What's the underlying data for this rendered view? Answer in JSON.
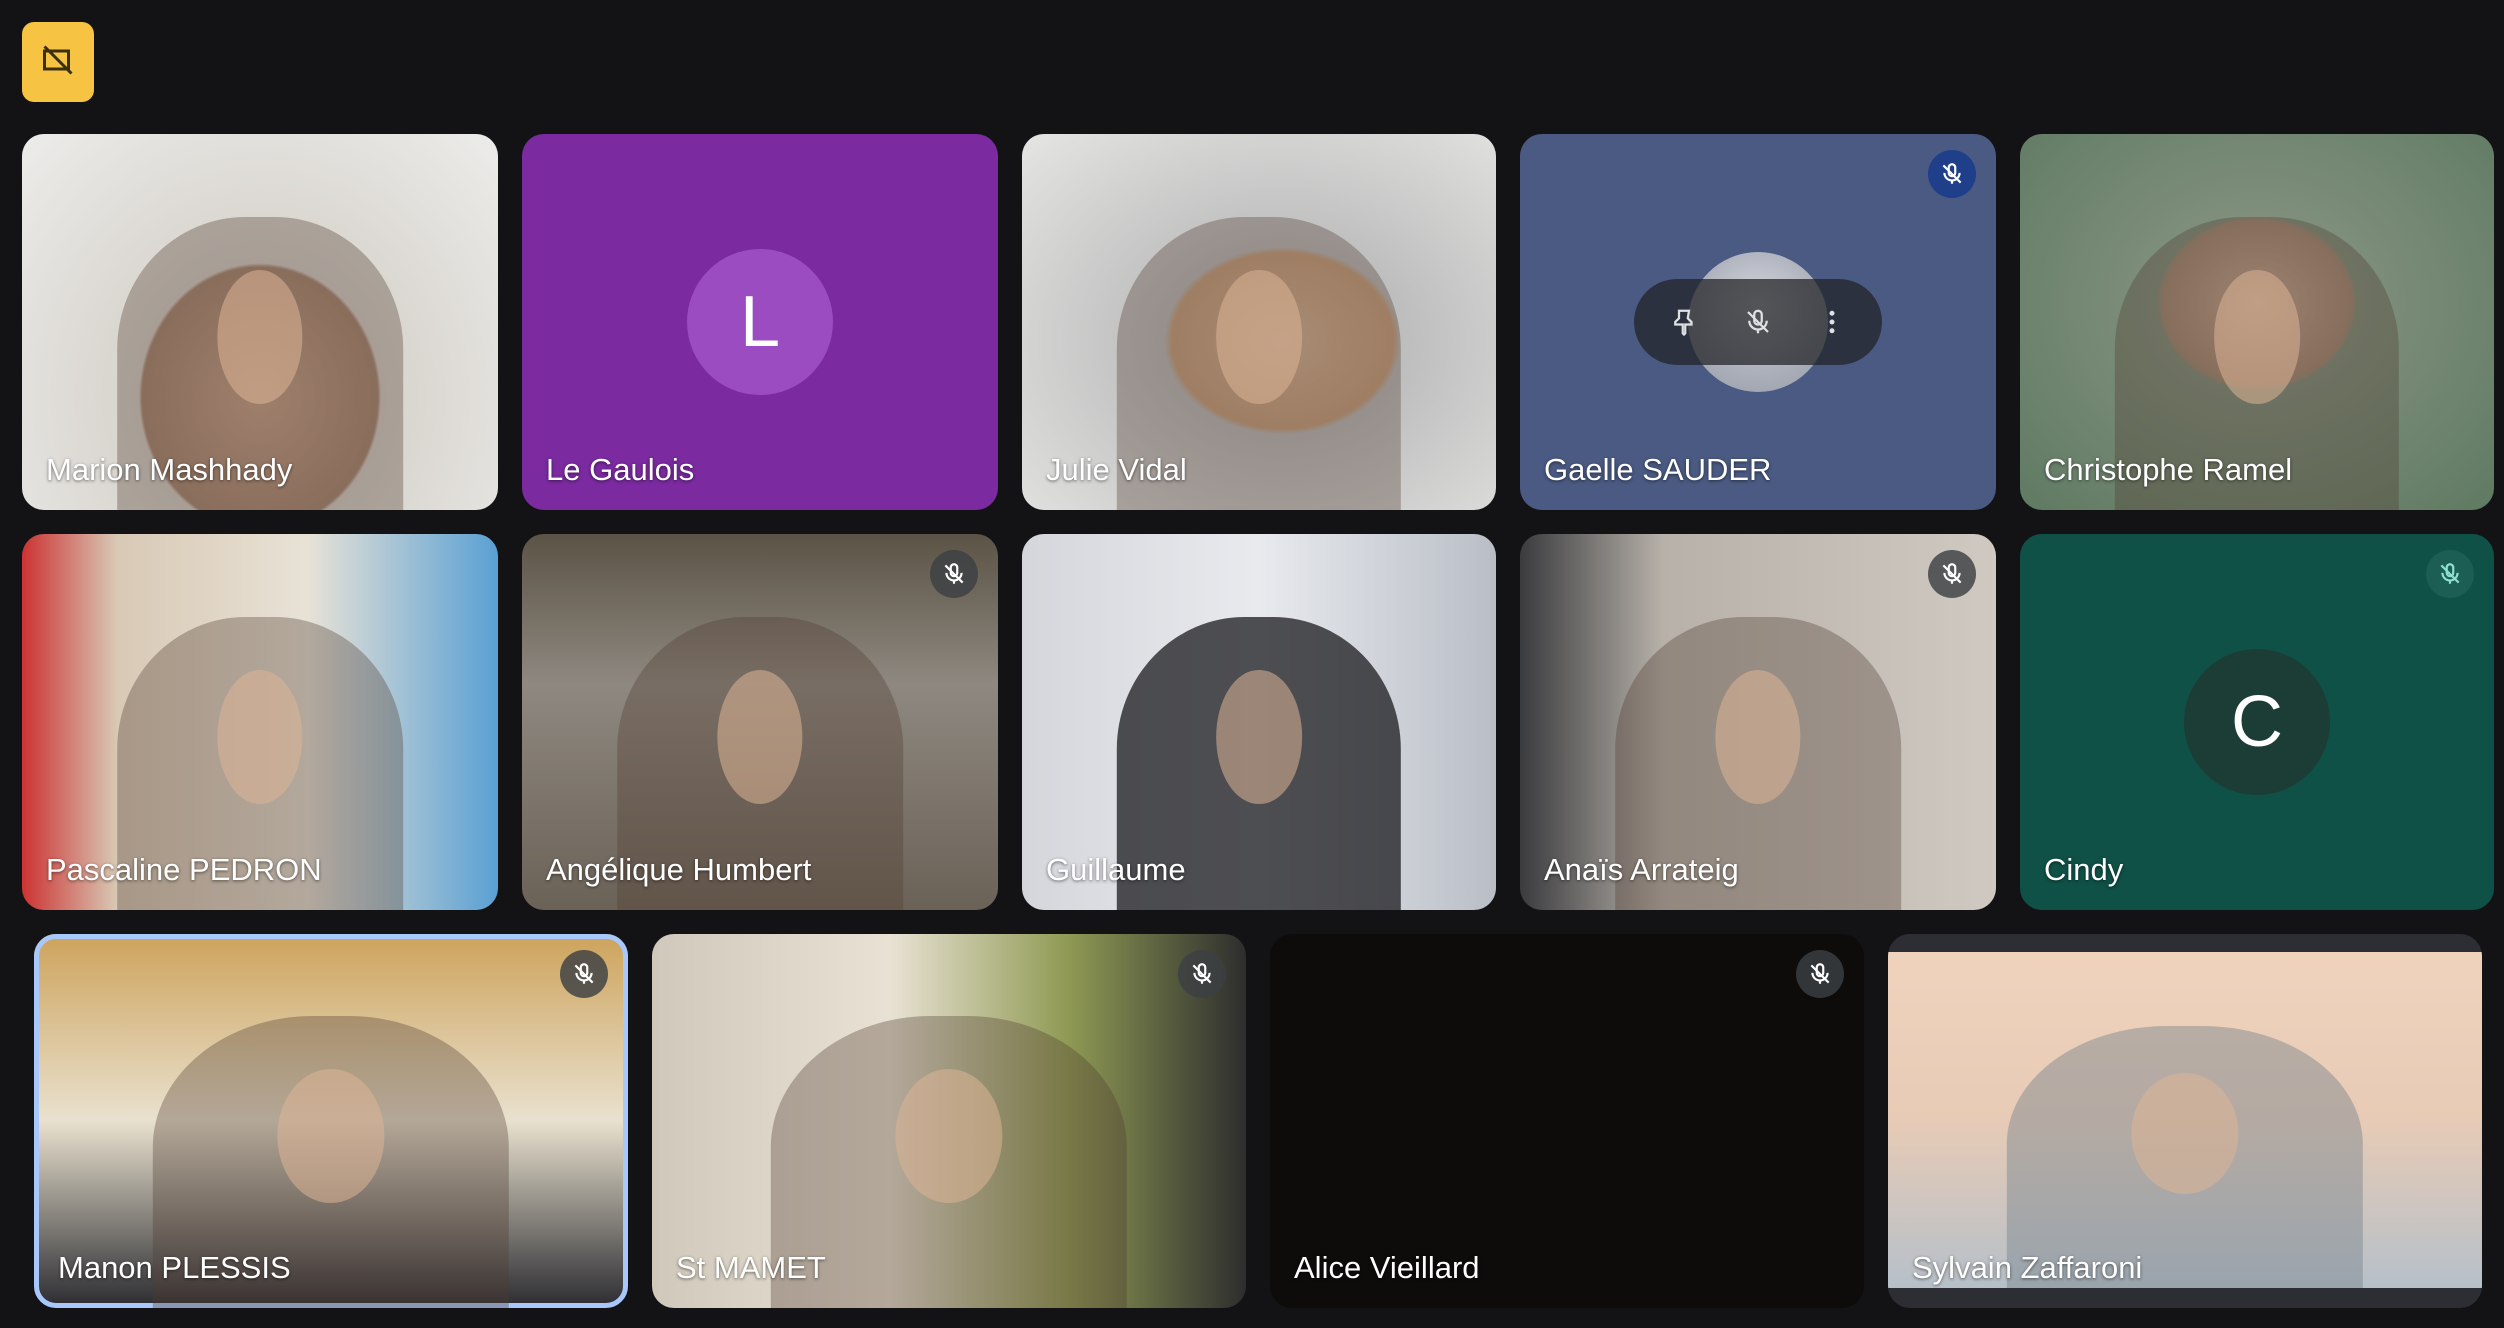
{
  "top_button": {
    "icon": "no-video-presentation-icon",
    "bg": "#f6c442"
  },
  "participants": [
    {
      "name": "Marion Mashhady",
      "muted": false
    },
    {
      "name": "Le Gaulois",
      "initial": "L",
      "tile_color": "#7b2aa0",
      "avatar_color": "#9b4cc0",
      "muted": false
    },
    {
      "name": "Julie Vidal",
      "muted": false
    },
    {
      "name": "Gaelle SAUDER",
      "muted": true,
      "tile_color": "#4a5a82"
    },
    {
      "name": "Christophe Ramel",
      "muted": false
    },
    {
      "name": "Pascaline PEDRON",
      "muted": false
    },
    {
      "name": "Angélique Humbert",
      "muted": true
    },
    {
      "name": "Guillaume",
      "muted": false
    },
    {
      "name": "Anaïs Arrateig",
      "muted": true
    },
    {
      "name": "Cindy",
      "initial": "C",
      "tile_color": "#0f5147",
      "avatar_color": "#1b3d36",
      "muted": true
    },
    {
      "name": "Manon PLESSIS",
      "muted": true,
      "active_speaker": true
    },
    {
      "name": "St MAMET",
      "muted": true
    },
    {
      "name": "Alice Vieillard",
      "muted": true,
      "tile_color": "#0e0c0b"
    },
    {
      "name": "Sylvain Zaffaroni",
      "muted": false
    }
  ],
  "hover_controls": {
    "items": [
      "pin-icon",
      "mic-off-icon",
      "more-vert-icon"
    ]
  }
}
